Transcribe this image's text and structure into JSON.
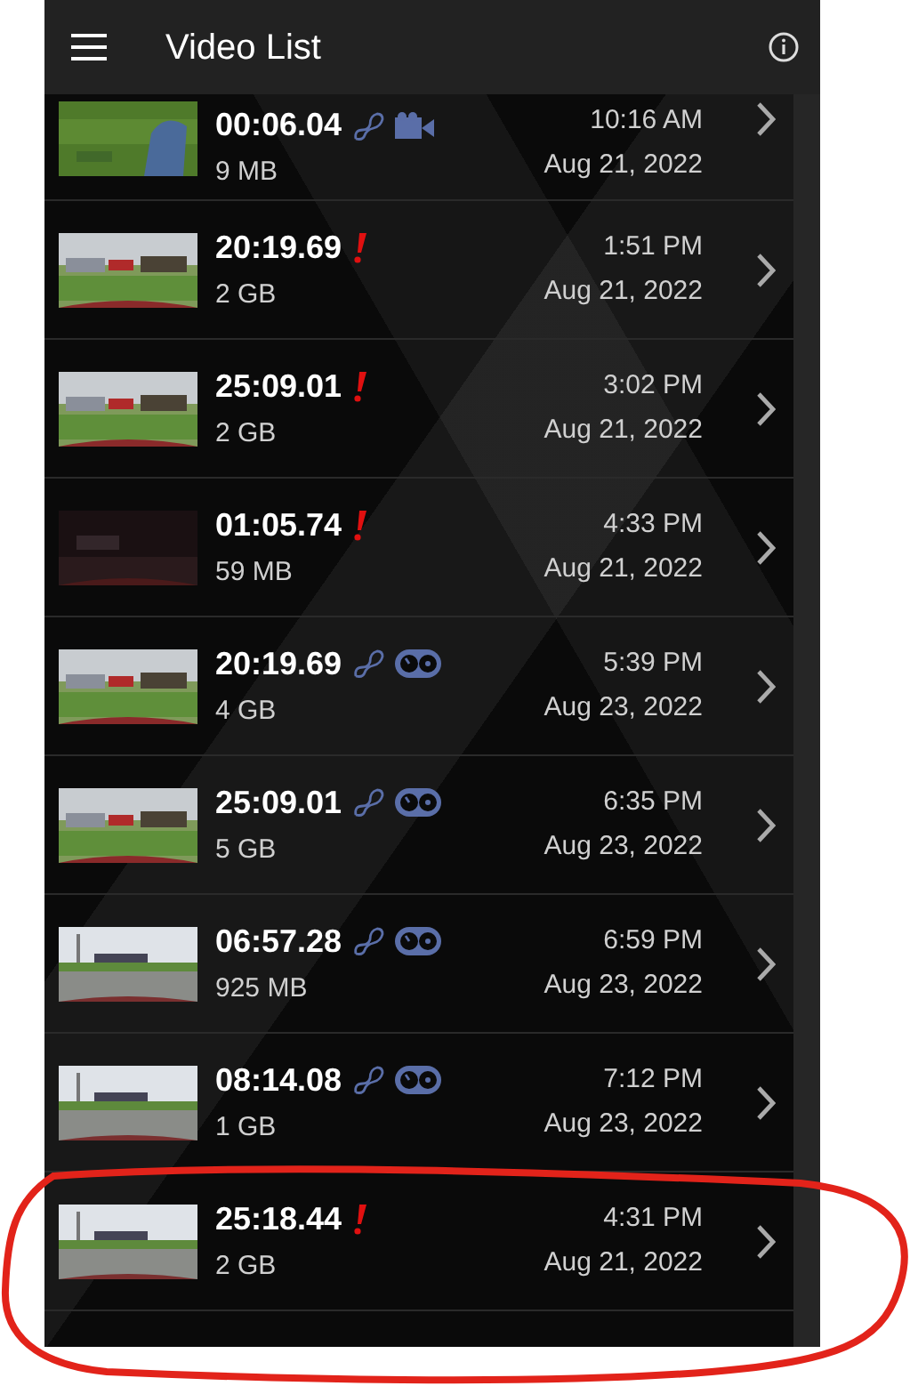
{
  "app_bar": {
    "title": "Video List"
  },
  "videos": [
    {
      "duration": "00:06.04",
      "size": "9 MB",
      "time": "10:16 AM",
      "date": "Aug 21, 2022",
      "badges": [
        {
          "kind": "link"
        },
        {
          "kind": "camera"
        }
      ]
    },
    {
      "duration": "20:19.69",
      "size": "2 GB",
      "time": "1:51 PM",
      "date": "Aug 21, 2022",
      "badges": [
        {
          "kind": "warning"
        }
      ]
    },
    {
      "duration": "25:09.01",
      "size": "2 GB",
      "time": "3:02 PM",
      "date": "Aug 21, 2022",
      "badges": [
        {
          "kind": "warning"
        }
      ]
    },
    {
      "duration": "01:05.74",
      "size": "59 MB",
      "time": "4:33 PM",
      "date": "Aug 21, 2022",
      "badges": [
        {
          "kind": "warning"
        }
      ]
    },
    {
      "duration": "20:19.69",
      "size": "4 GB",
      "time": "5:39 PM",
      "date": "Aug 23, 2022",
      "badges": [
        {
          "kind": "link"
        },
        {
          "kind": "gauge"
        }
      ]
    },
    {
      "duration": "25:09.01",
      "size": "5 GB",
      "time": "6:35 PM",
      "date": "Aug 23, 2022",
      "badges": [
        {
          "kind": "link"
        },
        {
          "kind": "gauge"
        }
      ]
    },
    {
      "duration": "06:57.28",
      "size": "925 MB",
      "time": "6:59 PM",
      "date": "Aug 23, 2022",
      "badges": [
        {
          "kind": "link"
        },
        {
          "kind": "gauge"
        }
      ]
    },
    {
      "duration": "08:14.08",
      "size": "1 GB",
      "time": "7:12 PM",
      "date": "Aug 23, 2022",
      "badges": [
        {
          "kind": "link"
        },
        {
          "kind": "gauge"
        }
      ]
    },
    {
      "duration": "25:18.44",
      "size": "2 GB",
      "time": "4:31 PM",
      "date": "Aug 21, 2022",
      "badges": [
        {
          "kind": "warning"
        }
      ]
    }
  ]
}
